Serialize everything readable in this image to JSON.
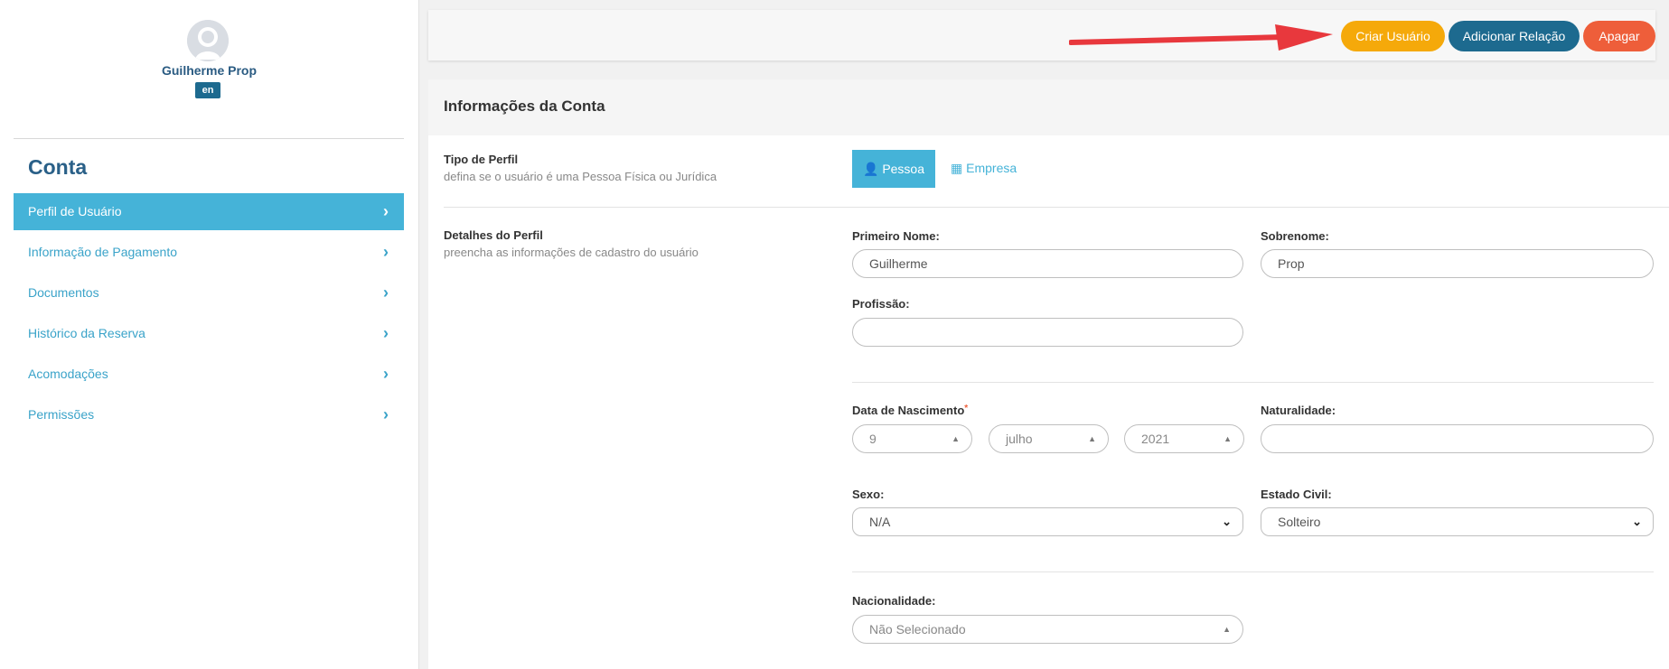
{
  "user": {
    "name": "Guilherme Prop",
    "lang": "en"
  },
  "sidebar": {
    "title": "Conta",
    "items": [
      {
        "label": "Perfil de Usuário",
        "active": true
      },
      {
        "label": "Informação de Pagamento",
        "active": false
      },
      {
        "label": "Documentos",
        "active": false
      },
      {
        "label": "Histórico da Reserva",
        "active": false
      },
      {
        "label": "Acomodações",
        "active": false
      },
      {
        "label": "Permissões",
        "active": false
      }
    ]
  },
  "toolbar": {
    "create_label": "Criar Usuário",
    "relation_label": "Adicionar Relação",
    "delete_label": "Apagar"
  },
  "account": {
    "title": "Informações da Conta",
    "profile_type": {
      "title": "Tipo de Perfil",
      "desc": "defina se o usuário é uma Pessoa Física ou Jurídica",
      "person_label": "Pessoa",
      "company_label": "Empresa"
    },
    "details": {
      "title": "Detalhes do Perfil",
      "desc": "preencha as informações de cadastro do usuário"
    },
    "fields": {
      "first_name": {
        "label": "Primeiro Nome:",
        "value": "Guilherme"
      },
      "last_name": {
        "label": "Sobrenome:",
        "value": "Prop"
      },
      "profession": {
        "label": "Profissão:",
        "value": ""
      },
      "birth": {
        "label": "Data de Nascimento",
        "required_mark": "*",
        "day": "9",
        "month": "julho",
        "year": "2021"
      },
      "birthplace": {
        "label": "Naturalidade:",
        "value": ""
      },
      "sex": {
        "label": "Sexo:",
        "value": "N/A"
      },
      "civil_status": {
        "label": "Estado Civil:",
        "value": "Solteiro"
      },
      "nationality": {
        "label": "Nacionalidade:",
        "value": "Não Selecionado"
      }
    }
  },
  "colors": {
    "accent": "#45b3d8",
    "create": "#f5a90a",
    "relation": "#1d6a8f",
    "delete": "#ee5e3a",
    "arrow": "#e8383d"
  },
  "icons": {
    "menu_chevron": "chevron-right-icon",
    "person": "user-icon",
    "company": "building-icon",
    "select_up": "caret-up-icon",
    "select_down": "chevron-down-icon"
  }
}
